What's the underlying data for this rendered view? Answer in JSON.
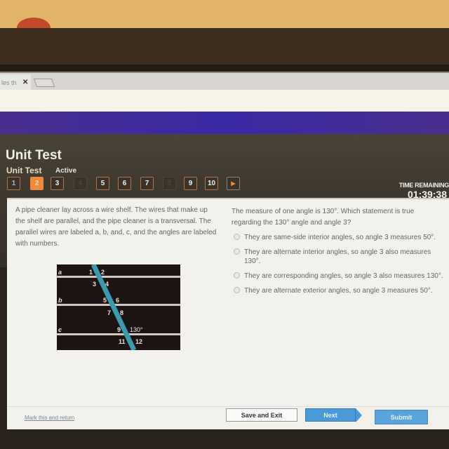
{
  "browser": {
    "tab_title": "les th",
    "tab_close": "✕"
  },
  "header": {
    "title": "Unit Test",
    "subtitle": "Unit Test",
    "status": "Active",
    "questions": [
      {
        "label": "1",
        "state": "answered"
      },
      {
        "label": "2",
        "state": "current"
      },
      {
        "label": "3",
        "state": "default"
      },
      {
        "label": "4",
        "state": "disabled"
      },
      {
        "label": "5",
        "state": "default"
      },
      {
        "label": "6",
        "state": "default"
      },
      {
        "label": "7",
        "state": "default"
      },
      {
        "label": "8",
        "state": "disabled"
      },
      {
        "label": "9",
        "state": "default"
      },
      {
        "label": "10",
        "state": "default"
      }
    ],
    "next_arrow": "▶",
    "timer_label": "TIME REMAINING",
    "timer_value": "01:39:38"
  },
  "question": {
    "passage": "A pipe cleaner lay across a wire shelf. The wires that make up the shelf are parallel, and the pipe cleaner is a transversal. The parallel wires are labeled a, b, and, c, and the angles are labeled with numbers.",
    "prompt": "The measure of one angle is 130°. Which statement is true regarding the 130° angle and angle 3?",
    "options": [
      "They are same-side interior angles, so angle 3 measures 50°.",
      "They are alternate interior angles, so angle 3 also measures 130°.",
      "They are corresponding angles, so angle 3 also measures 130°.",
      "They are alternate exterior angles, so angle 3 measures 50°."
    ],
    "diagram": {
      "wire_labels": [
        "a",
        "b",
        "c"
      ],
      "angle_labels": [
        "1",
        "2",
        "3",
        "4",
        "5",
        "6",
        "7",
        "8",
        "9",
        "130°",
        "11",
        "12"
      ]
    }
  },
  "footer": {
    "mark_label": "Mark this and return",
    "save_label": "Save and Exit",
    "next_label": "Next",
    "submit_label": "Submit"
  },
  "colors": {
    "accent_orange": "#f0893a",
    "button_blue": "#4a9ad8",
    "pipe_cleaner": "#3a9ab0"
  }
}
